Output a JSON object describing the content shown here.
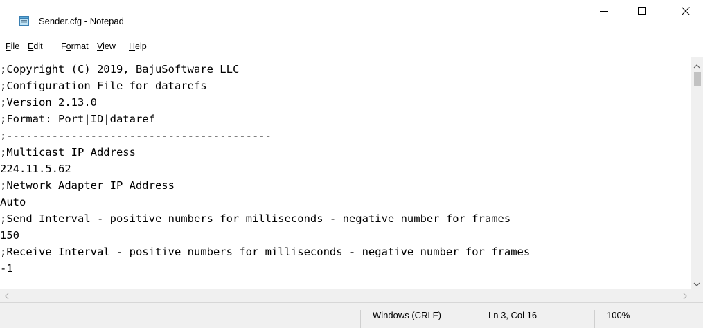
{
  "window": {
    "title": "Sender.cfg - Notepad"
  },
  "menu": {
    "items": [
      {
        "pre": "",
        "ul": "F",
        "post": "ile"
      },
      {
        "pre": "",
        "ul": "E",
        "post": "dit"
      },
      {
        "pre": "F",
        "ul": "o",
        "post": "rmat"
      },
      {
        "pre": "",
        "ul": "V",
        "post": "iew"
      },
      {
        "pre": "",
        "ul": "H",
        "post": "elp"
      }
    ]
  },
  "editor": {
    "lines": [
      ";Copyright (C) 2019, BajuSoftware LLC",
      ";Configuration File for datarefs",
      ";Version 2.13.0",
      ";Format: Port|ID|dataref",
      ";-----------------------------------------",
      ";Multicast IP Address",
      "224.11.5.62",
      ";Network Adapter IP Address",
      "Auto",
      ";Send Interval - positive numbers for milliseconds - negative number for frames",
      "150",
      ";Receive Interval - positive numbers for milliseconds - negative number for frames",
      "-1"
    ]
  },
  "status": {
    "line_ending": "Windows (CRLF)",
    "position": "Ln 3, Col 16",
    "zoom": "100%"
  },
  "icons": {
    "app": "notepad-icon",
    "minimize": "minimize-icon",
    "maximize": "maximize-icon",
    "close": "close-icon"
  }
}
